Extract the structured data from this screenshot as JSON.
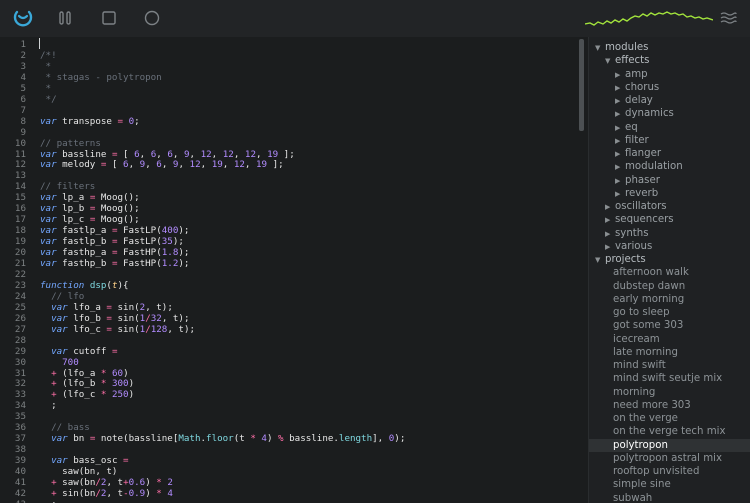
{
  "toolbar": {
    "icons": [
      "refresh-icon",
      "pause-icon",
      "stop-icon",
      "record-icon",
      "menu-icon"
    ],
    "accent": "#3aa8d8",
    "scope_color": "#a2e33c"
  },
  "editor": {
    "lines": [
      {
        "n": "1",
        "t": []
      },
      {
        "n": "2",
        "t": [
          [
            "c-cm",
            "/*!"
          ]
        ]
      },
      {
        "n": "3",
        "t": [
          [
            "c-cm",
            " *"
          ]
        ]
      },
      {
        "n": "4",
        "t": [
          [
            "c-cm",
            " * stagas - polytropon"
          ]
        ]
      },
      {
        "n": "5",
        "t": [
          [
            "c-cm",
            " *"
          ]
        ]
      },
      {
        "n": "6",
        "t": [
          [
            "c-cm",
            " */"
          ]
        ]
      },
      {
        "n": "7",
        "t": []
      },
      {
        "n": "8",
        "t": [
          [
            "c-kw",
            "var"
          ],
          [
            "c-pl",
            " transpose "
          ],
          [
            "c-op",
            "="
          ],
          [
            "c-pl",
            " "
          ],
          [
            "c-num",
            "0"
          ],
          [
            "c-pl",
            ";"
          ]
        ]
      },
      {
        "n": "9",
        "t": []
      },
      {
        "n": "10",
        "t": [
          [
            "c-cm",
            "// patterns"
          ]
        ]
      },
      {
        "n": "11",
        "t": [
          [
            "c-kw",
            "var"
          ],
          [
            "c-pl",
            " bassline "
          ],
          [
            "c-op",
            "="
          ],
          [
            "c-pl",
            " [ "
          ],
          [
            "c-num",
            "6"
          ],
          [
            "c-pl",
            ", "
          ],
          [
            "c-num",
            "6"
          ],
          [
            "c-pl",
            ", "
          ],
          [
            "c-num",
            "6"
          ],
          [
            "c-pl",
            ", "
          ],
          [
            "c-num",
            "9"
          ],
          [
            "c-pl",
            ", "
          ],
          [
            "c-num",
            "12"
          ],
          [
            "c-pl",
            ", "
          ],
          [
            "c-num",
            "12"
          ],
          [
            "c-pl",
            ", "
          ],
          [
            "c-num",
            "12"
          ],
          [
            "c-pl",
            ", "
          ],
          [
            "c-num",
            "19"
          ],
          [
            "c-pl",
            " ];"
          ]
        ]
      },
      {
        "n": "12",
        "t": [
          [
            "c-kw",
            "var"
          ],
          [
            "c-pl",
            " melody "
          ],
          [
            "c-op",
            "="
          ],
          [
            "c-pl",
            " [ "
          ],
          [
            "c-num",
            "6"
          ],
          [
            "c-pl",
            ", "
          ],
          [
            "c-num",
            "9"
          ],
          [
            "c-pl",
            ", "
          ],
          [
            "c-num",
            "6"
          ],
          [
            "c-pl",
            ", "
          ],
          [
            "c-num",
            "9"
          ],
          [
            "c-pl",
            ", "
          ],
          [
            "c-num",
            "12"
          ],
          [
            "c-pl",
            ", "
          ],
          [
            "c-num",
            "19"
          ],
          [
            "c-pl",
            ", "
          ],
          [
            "c-num",
            "12"
          ],
          [
            "c-pl",
            ", "
          ],
          [
            "c-num",
            "19"
          ],
          [
            "c-pl",
            " ];"
          ]
        ]
      },
      {
        "n": "13",
        "t": []
      },
      {
        "n": "14",
        "t": [
          [
            "c-cm",
            "// filters"
          ]
        ]
      },
      {
        "n": "15",
        "t": [
          [
            "c-kw",
            "var"
          ],
          [
            "c-pl",
            " lp_a "
          ],
          [
            "c-op",
            "="
          ],
          [
            "c-pl",
            " Moog();"
          ]
        ]
      },
      {
        "n": "16",
        "t": [
          [
            "c-kw",
            "var"
          ],
          [
            "c-pl",
            " lp_b "
          ],
          [
            "c-op",
            "="
          ],
          [
            "c-pl",
            " Moog();"
          ]
        ]
      },
      {
        "n": "17",
        "t": [
          [
            "c-kw",
            "var"
          ],
          [
            "c-pl",
            " lp_c "
          ],
          [
            "c-op",
            "="
          ],
          [
            "c-pl",
            " Moog();"
          ]
        ]
      },
      {
        "n": "18",
        "t": [
          [
            "c-kw",
            "var"
          ],
          [
            "c-pl",
            " fastlp_a "
          ],
          [
            "c-op",
            "="
          ],
          [
            "c-pl",
            " FastLP("
          ],
          [
            "c-num",
            "400"
          ],
          [
            "c-pl",
            ");"
          ]
        ]
      },
      {
        "n": "19",
        "t": [
          [
            "c-kw",
            "var"
          ],
          [
            "c-pl",
            " fastlp_b "
          ],
          [
            "c-op",
            "="
          ],
          [
            "c-pl",
            " FastLP("
          ],
          [
            "c-num",
            "35"
          ],
          [
            "c-pl",
            ");"
          ]
        ]
      },
      {
        "n": "20",
        "t": [
          [
            "c-kw",
            "var"
          ],
          [
            "c-pl",
            " fasthp_a "
          ],
          [
            "c-op",
            "="
          ],
          [
            "c-pl",
            " FastHP("
          ],
          [
            "c-num",
            "1.8"
          ],
          [
            "c-pl",
            ");"
          ]
        ]
      },
      {
        "n": "21",
        "t": [
          [
            "c-kw",
            "var"
          ],
          [
            "c-pl",
            " fasthp_b "
          ],
          [
            "c-op",
            "="
          ],
          [
            "c-pl",
            " FastHP("
          ],
          [
            "c-num",
            "1.2"
          ],
          [
            "c-pl",
            ");"
          ]
        ]
      },
      {
        "n": "22",
        "t": []
      },
      {
        "n": "23",
        "t": [
          [
            "c-kw",
            "function"
          ],
          [
            "c-pl",
            " "
          ],
          [
            "c-fn",
            "dsp"
          ],
          [
            "c-pl",
            "("
          ],
          [
            "c-it",
            "t"
          ],
          [
            "c-pl",
            "){"
          ]
        ]
      },
      {
        "n": "24",
        "t": [
          [
            "c-cm",
            "  // lfo"
          ]
        ]
      },
      {
        "n": "25",
        "t": [
          [
            "c-pl",
            "  "
          ],
          [
            "c-kw",
            "var"
          ],
          [
            "c-pl",
            " lfo_a "
          ],
          [
            "c-op",
            "="
          ],
          [
            "c-pl",
            " sin("
          ],
          [
            "c-num",
            "2"
          ],
          [
            "c-pl",
            ", t);"
          ]
        ]
      },
      {
        "n": "26",
        "t": [
          [
            "c-pl",
            "  "
          ],
          [
            "c-kw",
            "var"
          ],
          [
            "c-pl",
            " lfo_b "
          ],
          [
            "c-op",
            "="
          ],
          [
            "c-pl",
            " sin("
          ],
          [
            "c-num",
            "1"
          ],
          [
            "c-op",
            "/"
          ],
          [
            "c-num",
            "32"
          ],
          [
            "c-pl",
            ", t);"
          ]
        ]
      },
      {
        "n": "27",
        "t": [
          [
            "c-pl",
            "  "
          ],
          [
            "c-kw",
            "var"
          ],
          [
            "c-pl",
            " lfo_c "
          ],
          [
            "c-op",
            "="
          ],
          [
            "c-pl",
            " sin("
          ],
          [
            "c-num",
            "1"
          ],
          [
            "c-op",
            "/"
          ],
          [
            "c-num",
            "128"
          ],
          [
            "c-pl",
            ", t);"
          ]
        ]
      },
      {
        "n": "28",
        "t": []
      },
      {
        "n": "29",
        "t": [
          [
            "c-pl",
            "  "
          ],
          [
            "c-kw",
            "var"
          ],
          [
            "c-pl",
            " cutoff "
          ],
          [
            "c-op",
            "="
          ]
        ]
      },
      {
        "n": "30",
        "t": [
          [
            "c-pl",
            "    "
          ],
          [
            "c-num",
            "700"
          ]
        ]
      },
      {
        "n": "31",
        "t": [
          [
            "c-pl",
            "  "
          ],
          [
            "c-op",
            "+"
          ],
          [
            "c-pl",
            " (lfo_a "
          ],
          [
            "c-op",
            "*"
          ],
          [
            "c-pl",
            " "
          ],
          [
            "c-num",
            "60"
          ],
          [
            "c-pl",
            ")"
          ]
        ]
      },
      {
        "n": "32",
        "t": [
          [
            "c-pl",
            "  "
          ],
          [
            "c-op",
            "+"
          ],
          [
            "c-pl",
            " (lfo_b "
          ],
          [
            "c-op",
            "*"
          ],
          [
            "c-pl",
            " "
          ],
          [
            "c-num",
            "300"
          ],
          [
            "c-pl",
            ")"
          ]
        ]
      },
      {
        "n": "33",
        "t": [
          [
            "c-pl",
            "  "
          ],
          [
            "c-op",
            "+"
          ],
          [
            "c-pl",
            " (lfo_c "
          ],
          [
            "c-op",
            "*"
          ],
          [
            "c-pl",
            " "
          ],
          [
            "c-num",
            "250"
          ],
          [
            "c-pl",
            ")"
          ]
        ]
      },
      {
        "n": "34",
        "t": [
          [
            "c-pl",
            "  ;"
          ]
        ]
      },
      {
        "n": "35",
        "t": []
      },
      {
        "n": "36",
        "t": [
          [
            "c-cm",
            "  // bass"
          ]
        ]
      },
      {
        "n": "37",
        "t": [
          [
            "c-pl",
            "  "
          ],
          [
            "c-kw",
            "var"
          ],
          [
            "c-pl",
            " bn "
          ],
          [
            "c-op",
            "="
          ],
          [
            "c-pl",
            " note(bassline["
          ],
          [
            "c-fn",
            "Math"
          ],
          [
            "c-pl",
            "."
          ],
          [
            "c-fn",
            "floor"
          ],
          [
            "c-pl",
            "(t "
          ],
          [
            "c-op",
            "*"
          ],
          [
            "c-pl",
            " "
          ],
          [
            "c-num",
            "4"
          ],
          [
            "c-pl",
            ") "
          ],
          [
            "c-op",
            "%"
          ],
          [
            "c-pl",
            " bassline."
          ],
          [
            "c-fn",
            "length"
          ],
          [
            "c-pl",
            "], "
          ],
          [
            "c-num",
            "0"
          ],
          [
            "c-pl",
            ");"
          ]
        ]
      },
      {
        "n": "38",
        "t": []
      },
      {
        "n": "39",
        "t": [
          [
            "c-pl",
            "  "
          ],
          [
            "c-kw",
            "var"
          ],
          [
            "c-pl",
            " bass_osc "
          ],
          [
            "c-op",
            "="
          ]
        ]
      },
      {
        "n": "40",
        "t": [
          [
            "c-pl",
            "    saw(bn, t)"
          ]
        ]
      },
      {
        "n": "41",
        "t": [
          [
            "c-pl",
            "  "
          ],
          [
            "c-op",
            "+"
          ],
          [
            "c-pl",
            " saw(bn"
          ],
          [
            "c-op",
            "/"
          ],
          [
            "c-num",
            "2"
          ],
          [
            "c-pl",
            ", t"
          ],
          [
            "c-op",
            "+"
          ],
          [
            "c-num",
            "0.6"
          ],
          [
            "c-pl",
            ") "
          ],
          [
            "c-op",
            "*"
          ],
          [
            "c-pl",
            " "
          ],
          [
            "c-num",
            "2"
          ]
        ]
      },
      {
        "n": "42",
        "t": [
          [
            "c-pl",
            "  "
          ],
          [
            "c-op",
            "+"
          ],
          [
            "c-pl",
            " sin(bn"
          ],
          [
            "c-op",
            "/"
          ],
          [
            "c-num",
            "2"
          ],
          [
            "c-pl",
            ", t"
          ],
          [
            "c-op",
            "-"
          ],
          [
            "c-num",
            "0.9"
          ],
          [
            "c-pl",
            ") "
          ],
          [
            "c-op",
            "*"
          ],
          [
            "c-pl",
            " "
          ],
          [
            "c-num",
            "4"
          ]
        ]
      },
      {
        "n": "43",
        "t": [
          [
            "c-pl",
            "  ;"
          ]
        ]
      }
    ]
  },
  "sidebar": {
    "tree": [
      {
        "label": "modules",
        "depth": 0,
        "kind": "section",
        "open": true
      },
      {
        "label": "effects",
        "depth": 1,
        "kind": "section",
        "open": true
      },
      {
        "label": "amp",
        "depth": 2,
        "kind": "child",
        "open": false
      },
      {
        "label": "chorus",
        "depth": 2,
        "kind": "child",
        "open": false
      },
      {
        "label": "delay",
        "depth": 2,
        "kind": "child",
        "open": false
      },
      {
        "label": "dynamics",
        "depth": 2,
        "kind": "child",
        "open": false
      },
      {
        "label": "eq",
        "depth": 2,
        "kind": "child",
        "open": false
      },
      {
        "label": "filter",
        "depth": 2,
        "kind": "child",
        "open": false
      },
      {
        "label": "flanger",
        "depth": 2,
        "kind": "child",
        "open": false
      },
      {
        "label": "modulation",
        "depth": 2,
        "kind": "child",
        "open": false
      },
      {
        "label": "phaser",
        "depth": 2,
        "kind": "child",
        "open": false
      },
      {
        "label": "reverb",
        "depth": 2,
        "kind": "child",
        "open": false
      },
      {
        "label": "oscillators",
        "depth": 1,
        "kind": "child",
        "open": false
      },
      {
        "label": "sequencers",
        "depth": 1,
        "kind": "child",
        "open": false
      },
      {
        "label": "synths",
        "depth": 1,
        "kind": "child",
        "open": false
      },
      {
        "label": "various",
        "depth": 1,
        "kind": "child",
        "open": false
      },
      {
        "label": "projects",
        "depth": 0,
        "kind": "section",
        "open": true
      },
      {
        "label": "afternoon walk",
        "depth": 1,
        "kind": "project"
      },
      {
        "label": "dubstep dawn",
        "depth": 1,
        "kind": "project"
      },
      {
        "label": "early morning",
        "depth": 1,
        "kind": "project"
      },
      {
        "label": "go to sleep",
        "depth": 1,
        "kind": "project"
      },
      {
        "label": "got some 303",
        "depth": 1,
        "kind": "project"
      },
      {
        "label": "icecream",
        "depth": 1,
        "kind": "project"
      },
      {
        "label": "late morning",
        "depth": 1,
        "kind": "project"
      },
      {
        "label": "mind swift",
        "depth": 1,
        "kind": "project"
      },
      {
        "label": "mind swift seutje mix",
        "depth": 1,
        "kind": "project"
      },
      {
        "label": "morning",
        "depth": 1,
        "kind": "project"
      },
      {
        "label": "need more 303",
        "depth": 1,
        "kind": "project"
      },
      {
        "label": "on the verge",
        "depth": 1,
        "kind": "project"
      },
      {
        "label": "on the verge tech mix",
        "depth": 1,
        "kind": "project"
      },
      {
        "label": "polytropon",
        "depth": 1,
        "kind": "project",
        "selected": true
      },
      {
        "label": "polytropon astral mix",
        "depth": 1,
        "kind": "project"
      },
      {
        "label": "rooftop unvisited",
        "depth": 1,
        "kind": "project"
      },
      {
        "label": "simple sine",
        "depth": 1,
        "kind": "project"
      },
      {
        "label": "subwah",
        "depth": 1,
        "kind": "project"
      }
    ]
  }
}
